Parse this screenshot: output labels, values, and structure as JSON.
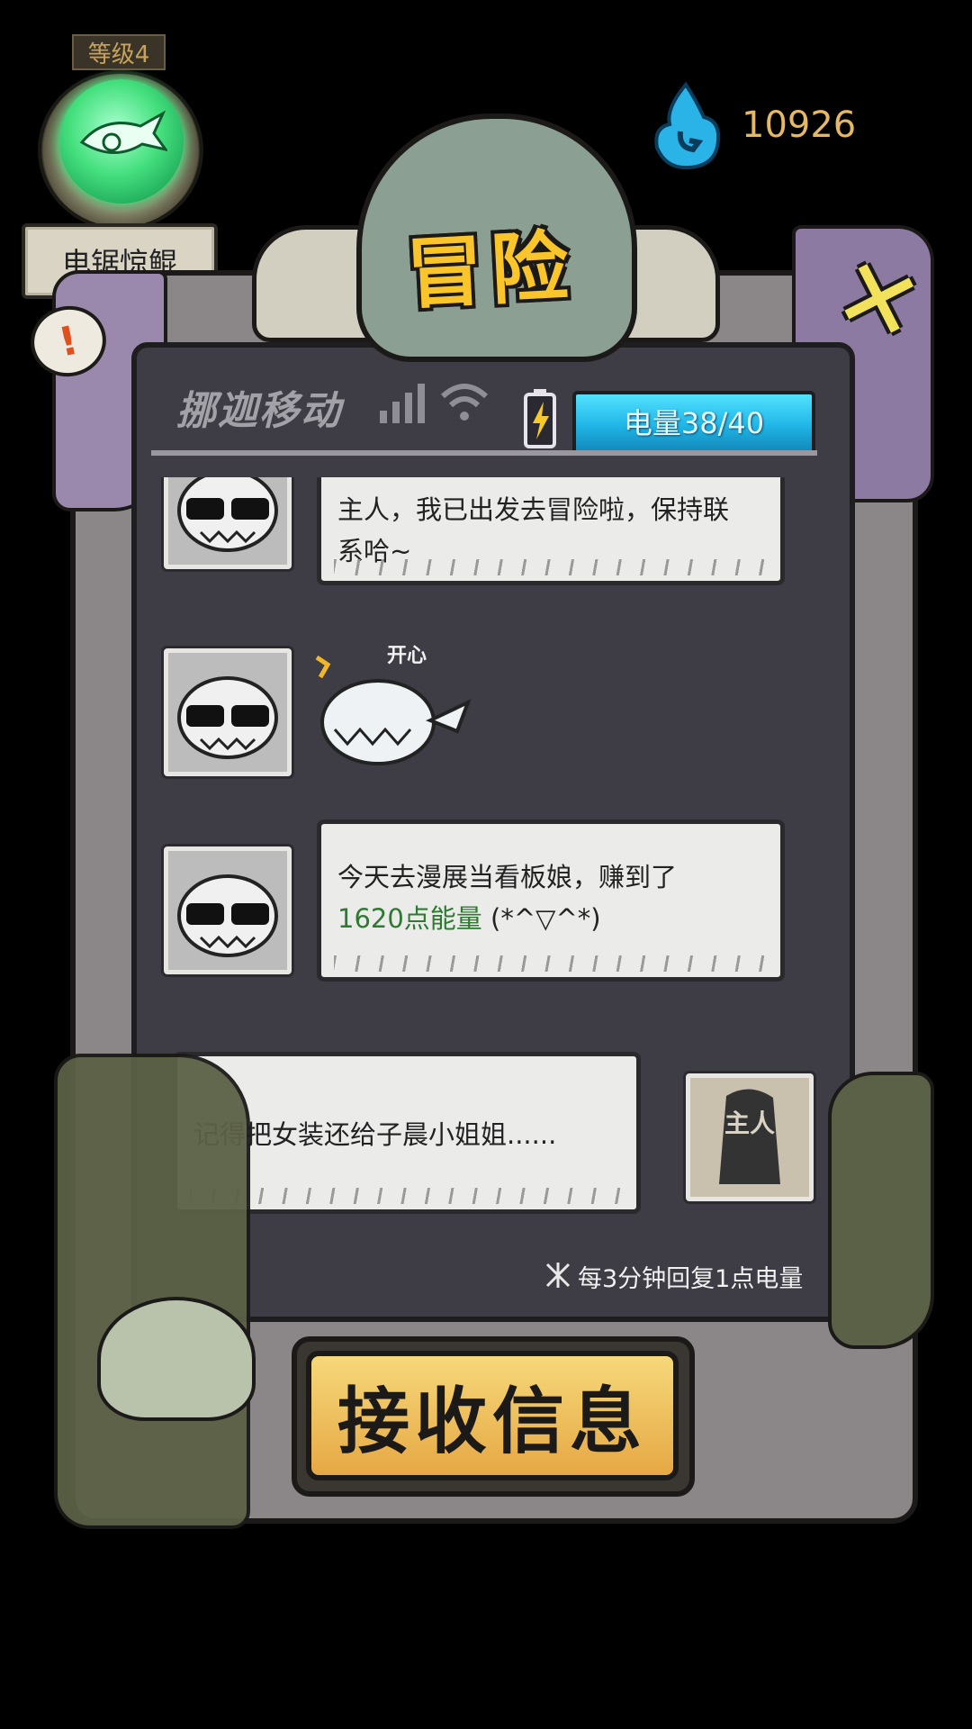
{
  "player": {
    "level_label": "等级4",
    "pet_name": "电锯惊鲲",
    "alert_mark": "!"
  },
  "currency": {
    "icon": "blue-flame-gem-icon",
    "value": "10926"
  },
  "header": {
    "title": "冒险",
    "close_symbol": "✕"
  },
  "status_bar": {
    "carrier": "挪迦移动",
    "energy_label": "电量38/40"
  },
  "messages": [
    {
      "from": "pet",
      "avatar": "shark-sunglasses-avatar",
      "lines": [
        "主人，我已出发去冒险啦，保持联",
        "系哈~"
      ]
    },
    {
      "from": "pet",
      "avatar": "shark-sunglasses-avatar",
      "sticker": "happy-shark-sticker",
      "sticker_text": "开心"
    },
    {
      "from": "pet",
      "avatar": "shark-sunglasses-avatar",
      "line1": "今天去漫展当看板娘，赚到了",
      "highlight": "1620点能量",
      "line2_tail": " (*^▽^*)"
    },
    {
      "from": "master",
      "avatar": "master-avatar",
      "avatar_text": "主人",
      "text": "记得把女装还给子晨小姐姐......"
    }
  ],
  "hint": "每3分钟回复1点电量",
  "receive_button": "接收信息",
  "colors": {
    "energy": "#1fb5e6",
    "highlight_green": "#2e7a32",
    "title": "#f9c52a",
    "button": "#e6a844"
  }
}
